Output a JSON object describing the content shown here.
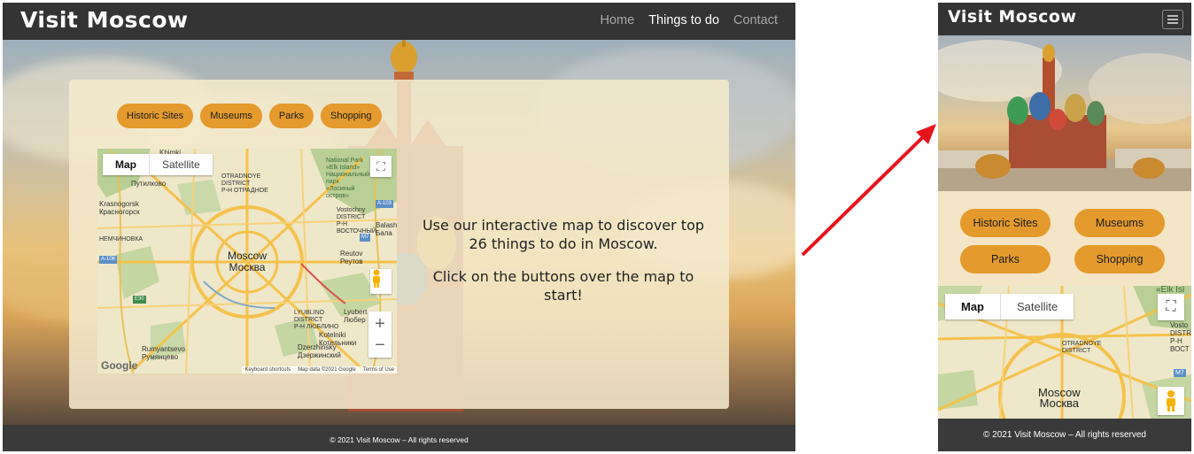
{
  "desktop": {
    "nav": {
      "brand": "Visit Moscow",
      "links": [
        {
          "label": "Home",
          "active": false
        },
        {
          "label": "Things to do",
          "active": true
        },
        {
          "label": "Contact",
          "active": false
        }
      ]
    },
    "categories": [
      "Historic Sites",
      "Museums",
      "Parks",
      "Shopping"
    ],
    "map": {
      "type_options": [
        "Map",
        "Satellite"
      ],
      "selected_type": "Map",
      "labels": {
        "khimki": "Khimki",
        "otradnoye": "OTRADNOYE\nDISTRICT\nР-Н ОТРАДНОЕ",
        "national_park": "National Park\n«Elk Island»\nНациональный\nпарк\n«Лосиный\nостров»",
        "putilkovo": "Путилково",
        "krasnogorsk": "Krasnogorsk\nКрасногорск",
        "vostochny": "Vostochny\nDISTRICT\nР-Н\nВОСТОЧНЫЙ",
        "balashikha": "Balashikha\nБала",
        "nemchinovka": "НЕМЧИНОВКА",
        "moscow": "Moscow\nМосква",
        "reutov": "Reutov\nРеутов",
        "lublino": "LYUBLINO\nDISTRICT\nР-Н ЛЮБЛИНО",
        "lyubertsy": "Lyubert\nЛюбер",
        "rumyantsevo": "Rumyantsevo\nРумянцево",
        "dzerzhinsky": "Dzerzhinsky\nДзержинский",
        "kotelniki": "Kotelniki\nКотельники",
        "a106": "A-106",
        "a103": "A-103",
        "m7": "M7",
        "e30": "E30",
        "logo": "Google"
      },
      "attribution": [
        "Keyboard shortcuts",
        "Map data ©2021 Google",
        "Terms of Use"
      ],
      "zoom_in": "+",
      "zoom_out": "−"
    },
    "intro": {
      "line1": "Use our interactive map to discover top 26 things to do in Moscow.",
      "line2": "Click on the buttons over the map to start!"
    },
    "footer": "© 2021 Visit Moscow – All rights reserved"
  },
  "mobile": {
    "nav": {
      "brand": "Visit Moscow",
      "menu_icon": "hamburger-icon"
    },
    "categories": [
      "Historic Sites",
      "Museums",
      "Parks",
      "Shopping"
    ],
    "map": {
      "type_options": [
        "Map",
        "Satellite"
      ],
      "selected_type": "Map",
      "labels": {
        "elk": "«Elk Isl",
        "otradnoye": "OTRADNOYE\nDISTRICT",
        "vosto": "Vosto\nDISTRIC\nР-Н\nВОСТ",
        "moscow": "Moscow\nМосква",
        "m7": "M7"
      }
    },
    "footer": "© 2021 Visit Moscow – All rights reserved"
  },
  "colors": {
    "navbar": "#343434",
    "accent_button": "#e49a2c",
    "panel": "#f5eacd",
    "footer": "#3a3a3a",
    "arrow": "#e8141c"
  }
}
